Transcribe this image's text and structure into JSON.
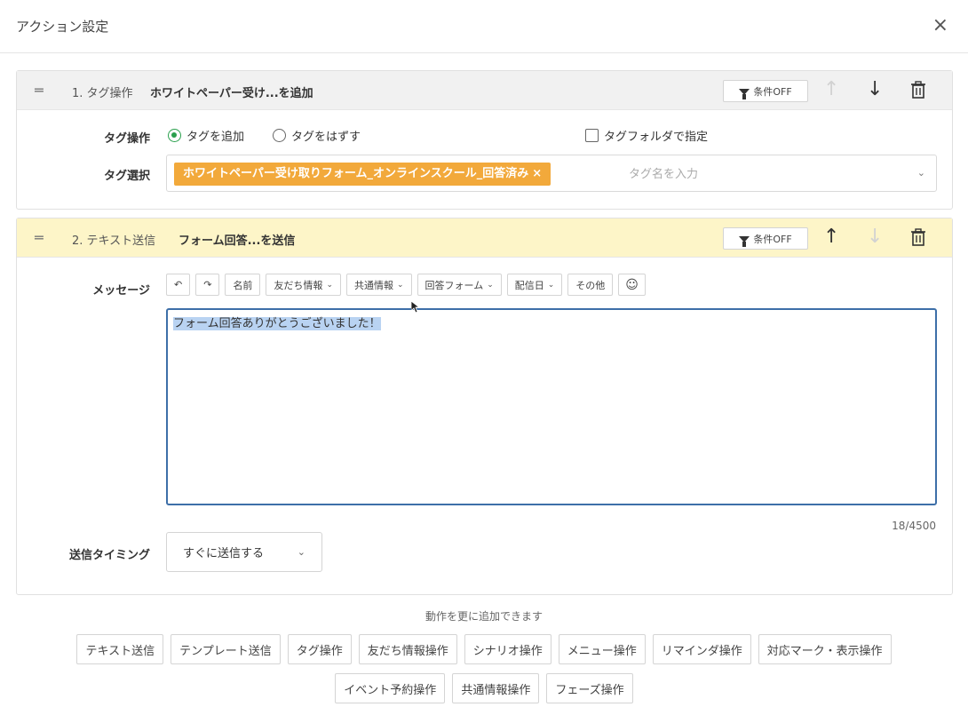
{
  "header": {
    "title": "アクション設定",
    "close": "×"
  },
  "actions": [
    {
      "number": "1. タグ操作",
      "summary": "ホワイトペーパー受け...を追加",
      "condition_label": "条件OFF",
      "tag_op_label": "タグ操作",
      "radio_add": "タグを追加",
      "radio_remove": "タグをはずす",
      "folder_checkbox": "タグフォルダで指定",
      "tag_select_label": "タグ選択",
      "selected_tag": "ホワイトペーパー受け取りフォーム_オンラインスクール_回答済み",
      "tag_remove": "×",
      "tag_placeholder": "タグ名を入力"
    },
    {
      "number": "2. テキスト送信",
      "summary": "フォーム回答...を送信",
      "condition_label": "条件OFF",
      "message_label": "メッセージ",
      "toolbar": {
        "undo": "↶",
        "redo": "↷",
        "name": "名前",
        "friend_info": "友だち情報",
        "shared_info": "共通情報",
        "answer_form": "回答フォーム",
        "delivery_date": "配信日",
        "other": "その他",
        "emoji": "☺"
      },
      "message_text": "フォーム回答ありがとうございました！",
      "counter": "18/4500",
      "timing_label": "送信タイミング",
      "timing_value": "すぐに送信する"
    }
  ],
  "add_more_text": "動作を更に追加できます",
  "action_buttons_row1": [
    "テキスト送信",
    "テンプレート送信",
    "タグ操作",
    "友だち情報操作",
    "シナリオ操作",
    "メニュー操作",
    "リマインダ操作",
    "対応マーク・表示操作"
  ],
  "action_buttons_row2": [
    "イベント予約操作",
    "共通情報操作",
    "フェーズ操作"
  ],
  "colors": {
    "tag_chip": "#f2a93b",
    "radio_green": "#2aa04d",
    "card2_header": "#fdf5c8",
    "textarea_border": "#3d6fa8"
  }
}
